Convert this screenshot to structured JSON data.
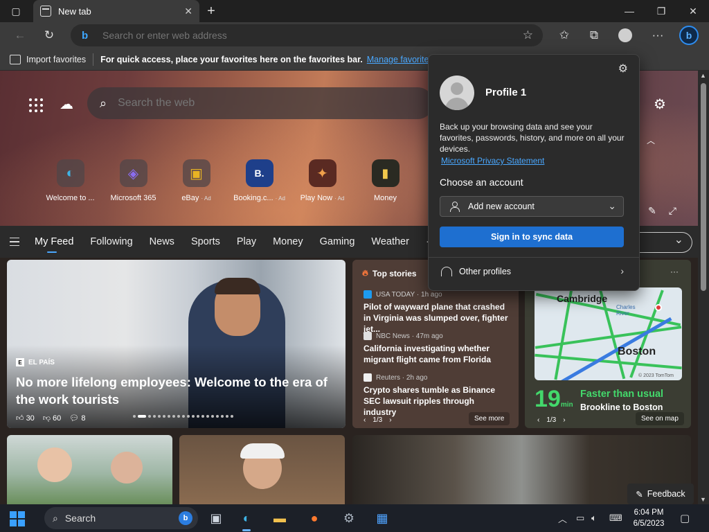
{
  "browser": {
    "tab_title": "New tab",
    "address_placeholder": "Search or enter web address"
  },
  "favorites_bar": {
    "import_label": "Import favorites",
    "hint": "For quick access, place your favorites here on the favorites bar.",
    "manage_link": "Manage favorites now"
  },
  "newtab": {
    "search_placeholder": "Search the web",
    "quick_links": [
      {
        "label": "Welcome to ...",
        "ad": "",
        "glyph": "◐",
        "color": "#3fb4e6"
      },
      {
        "label": "Microsoft 365",
        "ad": "",
        "glyph": "◈",
        "color": "#8a6cf0"
      },
      {
        "label": "eBay",
        "ad": "· Ad",
        "glyph": "▣",
        "color": "#e8b323"
      },
      {
        "label": "Booking.c...",
        "ad": "· Ad",
        "glyph": "B.",
        "color": "#1e5bc4"
      },
      {
        "label": "Play Now",
        "ad": "· Ad",
        "glyph": "✦",
        "color": "#c0392b"
      },
      {
        "label": "Money",
        "ad": "",
        "glyph": "▮",
        "color": "#f2c94c"
      }
    ],
    "feed_tabs": [
      "My Feed",
      "Following",
      "News",
      "Sports",
      "Play",
      "Money",
      "Gaming",
      "Weather"
    ],
    "feed_more": "···"
  },
  "main_story": {
    "source": "EL PAÍS",
    "source_logo": "E",
    "headline": "No more lifelong employees: Welcome to the era of the work tourists",
    "likes": "30",
    "dislikes": "60",
    "comments": "8"
  },
  "top_stories": {
    "title": "Top stories",
    "items": [
      {
        "source": "USA TODAY",
        "time": "· 1h ago",
        "color": "#1d9bf0",
        "headline": "Pilot of wayward plane that crashed in Virginia was slumped over, fighter jet..."
      },
      {
        "source": "NBC News",
        "time": "· 47m ago",
        "color": "#e0e0e0",
        "headline": "California investigating whether migrant flight came from Florida"
      },
      {
        "source": "Reuters",
        "time": "· 2h ago",
        "color": "#f0f0f0",
        "headline": "Crypto shares tumble as Binance SEC lawsuit ripples through industry"
      }
    ],
    "pager": "1/3",
    "see_more": "See more"
  },
  "traffic": {
    "menu": "···",
    "place_a": "Cambridge",
    "place_b": "Boston",
    "river_label": "Charles River",
    "map_credit": "© 2023 TomTom",
    "minutes": "19",
    "min_unit": "min",
    "status": "Faster than usual",
    "route": "Brookline to Boston",
    "pager": "1/3",
    "see_on_map": "See on map"
  },
  "feedback_label": "Feedback",
  "profile_flyout": {
    "profile_name": "Profile 1",
    "description": "Back up your browsing data and see your favorites, passwords, history, and more on all your devices.",
    "privacy_link": "Microsoft Privacy Statement",
    "choose_account": "Choose an account",
    "add_account": "Add new account",
    "sync_button": "Sign in to sync data",
    "other_profiles": "Other profiles"
  },
  "taskbar": {
    "search_label": "Search",
    "time": "6:04 PM",
    "date": "6/5/2023"
  }
}
